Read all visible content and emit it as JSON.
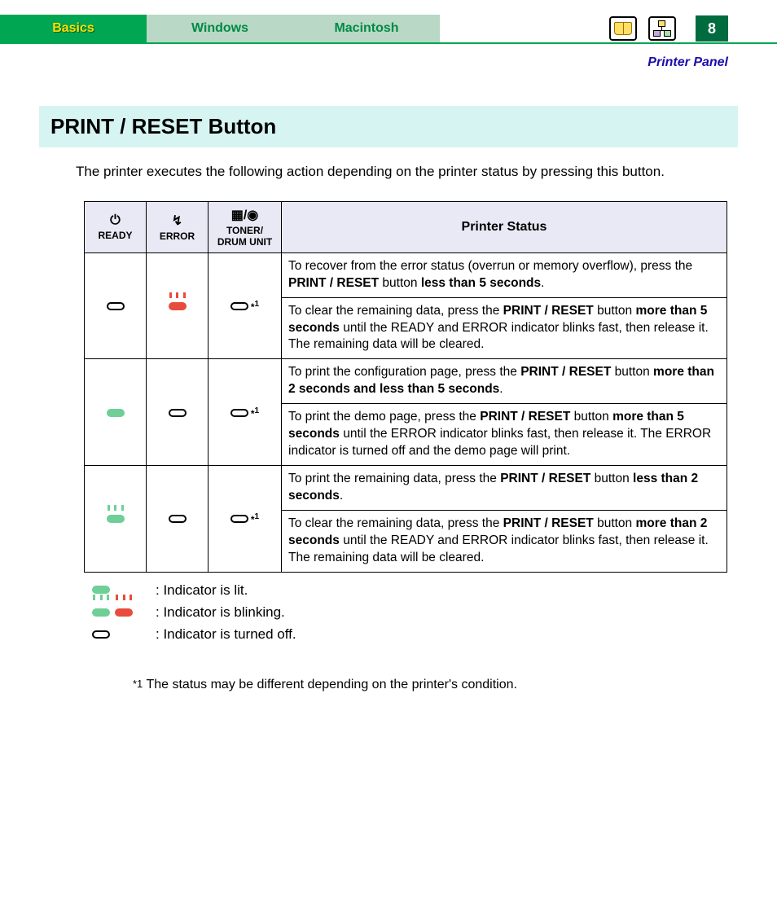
{
  "tabs": {
    "basics": "Basics",
    "windows": "Windows",
    "macintosh": "Macintosh"
  },
  "page_number": "8",
  "breadcrumb": "Printer Panel",
  "title": "PRINT / RESET Button",
  "intro": "The printer executes the following action depending on the printer status by pressing this button.",
  "headers": {
    "ready": "READY",
    "error": "ERROR",
    "toner": "TONER/ DRUM UNIT",
    "status": "Printer Status"
  },
  "star1": "*1",
  "rows": [
    {
      "r1a_pre": "To recover from the error status (overrun or memory overflow), press the ",
      "r1a_b1": "PRINT / RESET",
      "r1a_mid": " button ",
      "r1a_b2": "less than 5 seconds",
      "r1a_post": ".",
      "r1b_pre": "To clear the remaining data, press the ",
      "r1b_b1": "PRINT / RESET",
      "r1b_mid": " button ",
      "r1b_b2": "more than 5 seconds",
      "r1b_post": " until the READY and ERROR indicator blinks fast, then release it. The remaining data will be cleared."
    },
    {
      "r2a_pre": "To print the configuration page, press the ",
      "r2a_b1": "PRINT / RESET",
      "r2a_mid": " button ",
      "r2a_b2": "more than 2 seconds and less than 5 seconds",
      "r2a_post": ".",
      "r2b_pre": "To print the demo page, press the ",
      "r2b_b1": "PRINT / RESET",
      "r2b_mid": " button ",
      "r2b_b2": "more than 5 seconds",
      "r2b_post": " until the ERROR indicator blinks fast, then release it. The ERROR indicator is turned off and the demo page will print."
    },
    {
      "r3a_pre": "To print the remaining data, press the ",
      "r3a_b1": "PRINT / RESET",
      "r3a_mid": " button ",
      "r3a_b2": "less than 2 seconds",
      "r3a_post": ".",
      "r3b_pre": "To clear the remaining data, press the ",
      "r3b_b1": "PRINT / RESET",
      "r3b_mid": " button ",
      "r3b_b2": "more than 2 seconds",
      "r3b_post": " until the READY and ERROR indicator blinks fast, then release it. The remaining data will be cleared."
    }
  ],
  "legend": {
    "lit": ": Indicator is lit.",
    "blink": ": Indicator is blinking.",
    "off": ": Indicator is turned off."
  },
  "footnote": " The status may be different depending on the printer's condition."
}
